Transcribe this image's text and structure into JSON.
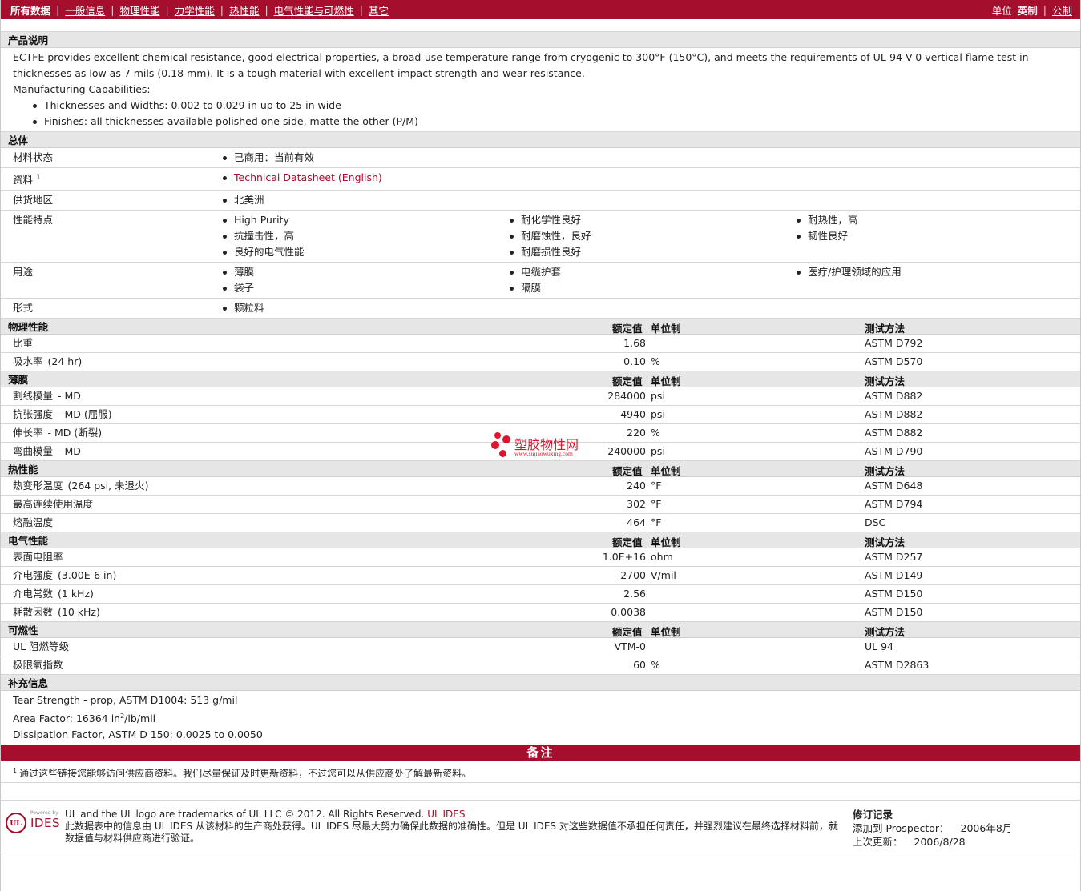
{
  "nav": {
    "all_data": "所有数据",
    "tabs": [
      "一般信息",
      "物理性能",
      "力学性能",
      "热性能",
      "电气性能与可燃性",
      "其它"
    ],
    "unit_label": "单位",
    "unit_english": "英制",
    "unit_metric": "公制"
  },
  "product_description": {
    "title": "产品说明",
    "paragraph": "ECTFE provides excellent chemical resistance, good electrical properties, a broad-use temperature range from cryogenic to 300°F (150°C), and meets the requirements of UL-94 V-0 vertical flame test in thicknesses as low as 7 mils (0.18 mm). It is a tough material with excellent impact strength and wear resistance.",
    "capabilities_title": "Manufacturing Capabilities:",
    "capabilities": [
      "Thicknesses and Widths: 0.002 to 0.029 in up to 25 in wide",
      "Finishes: all thicknesses available polished one side, matte the other (P/M)"
    ]
  },
  "general": {
    "title": "总体",
    "rows": [
      {
        "label": "材料状态",
        "sup": "",
        "cols": [
          [
            "已商用：当前有效"
          ]
        ]
      },
      {
        "label": "资料",
        "sup": "1",
        "cols": [
          [
            "Technical Datasheet (English)"
          ]
        ],
        "link": true
      },
      {
        "label": "供货地区",
        "sup": "",
        "cols": [
          [
            "北美洲"
          ]
        ]
      },
      {
        "label": "性能特点",
        "sup": "",
        "cols": [
          [
            "High Purity",
            "抗撞击性，高",
            "良好的电气性能"
          ],
          [
            "耐化学性良好",
            "耐磨蚀性，良好",
            "耐磨损性良好"
          ],
          [
            "耐热性，高",
            "韧性良好"
          ]
        ]
      },
      {
        "label": "用途",
        "sup": "",
        "cols": [
          [
            "薄膜",
            "袋子"
          ],
          [
            "电缆护套",
            "隔膜"
          ],
          [
            "医疗/护理领域的应用"
          ]
        ]
      },
      {
        "label": "形式",
        "sup": "",
        "cols": [
          [
            "颗粒料"
          ]
        ]
      }
    ]
  },
  "column_headers": {
    "nominal": "额定值",
    "unit": "单位制",
    "method": "测试方法"
  },
  "sections": [
    {
      "title": "物理性能",
      "rows": [
        {
          "prop": "比重",
          "cond": "",
          "nom": "1.68",
          "unit": "",
          "method": "ASTM D792"
        },
        {
          "prop": "吸水率",
          "cond": "(24 hr)",
          "nom": "0.10",
          "unit": "%",
          "method": "ASTM D570"
        }
      ]
    },
    {
      "title": "薄膜",
      "rows": [
        {
          "prop": "割线模量",
          "cond": "- MD",
          "nom": "284000",
          "unit": "psi",
          "method": "ASTM D882"
        },
        {
          "prop": "抗张强度",
          "cond": "- MD (屈服)",
          "nom": "4940",
          "unit": "psi",
          "method": "ASTM D882"
        },
        {
          "prop": "伸长率",
          "cond": "- MD (断裂)",
          "nom": "220",
          "unit": "%",
          "method": "ASTM D882"
        },
        {
          "prop": "弯曲模量",
          "cond": "- MD",
          "nom": "240000",
          "unit": "psi",
          "method": "ASTM D790"
        }
      ]
    },
    {
      "title": "热性能",
      "rows": [
        {
          "prop": "热变形温度",
          "cond": "(264 psi, 未退火)",
          "nom": "240",
          "unit": "°F",
          "method": "ASTM D648"
        },
        {
          "prop": "最高连续使用温度",
          "cond": "",
          "nom": "302",
          "unit": "°F",
          "method": "ASTM D794"
        },
        {
          "prop": "熔融温度",
          "cond": "",
          "nom": "464",
          "unit": "°F",
          "method": "DSC"
        }
      ]
    },
    {
      "title": "电气性能",
      "rows": [
        {
          "prop": "表面电阻率",
          "cond": "",
          "nom": "1.0E+16",
          "unit": "ohm",
          "method": "ASTM D257"
        },
        {
          "prop": "介电强度",
          "cond": "(3.00E-6 in)",
          "nom": "2700",
          "unit": "V/mil",
          "method": "ASTM D149"
        },
        {
          "prop": "介电常数",
          "cond": "(1 kHz)",
          "nom": "2.56",
          "unit": "",
          "method": "ASTM D150"
        },
        {
          "prop": "耗散因数",
          "cond": "(10 kHz)",
          "nom": "0.0038",
          "unit": "",
          "method": "ASTM D150"
        }
      ]
    },
    {
      "title": "可燃性",
      "rows": [
        {
          "prop": "UL 阻燃等级",
          "cond": "",
          "nom": "VTM-0",
          "unit": "",
          "method": "UL 94"
        },
        {
          "prop": "极限氧指数",
          "cond": "",
          "nom": "60",
          "unit": "%",
          "method": "ASTM D2863"
        }
      ]
    }
  ],
  "supplemental": {
    "title": "补充信息",
    "line1": "Tear Strength - prop, ASTM D1004: 513 g/mil",
    "line2_prefix": "Area Factor: 16364 in",
    "line2_sup": "2",
    "line2_suffix": "/lb/mil",
    "line3": "Dissipation Factor, ASTM D 150: 0.0025 to 0.0050"
  },
  "notes": {
    "title": "备注",
    "sup": "1",
    "text": "通过这些链接您能够访问供应商资料。我们尽量保证及时更新资料，不过您可以从供应商处了解最新资料。"
  },
  "footer": {
    "logo_ul": "UL",
    "logo_powered": "Powered by",
    "logo_ides": "IDES",
    "trademark": "UL and the UL logo are trademarks of UL LLC © 2012. All Rights Reserved.",
    "ul_ides": "UL IDES",
    "disclaimer": "此数据表中的信息由 UL IDES 从该材料的生产商处获得。UL IDES 尽最大努力确保此数据的准确性。但是 UL IDES 对这些数据值不承担任何责任，并强烈建议在最终选择材料前，就数据值与材料供应商进行验证。",
    "revision_title": "修订记录",
    "added_label": "添加到 Prospector：",
    "added_value": "2006年8月",
    "updated_label": "上次更新：",
    "updated_value": "2006/8/28"
  },
  "watermark": {
    "text": "塑胶物性网",
    "url": "www.sujiaowuxing.com",
    "color": "#e0142d"
  },
  "colors": {
    "brand": "#a50f2d",
    "section_bg": "#e6e6e6"
  }
}
